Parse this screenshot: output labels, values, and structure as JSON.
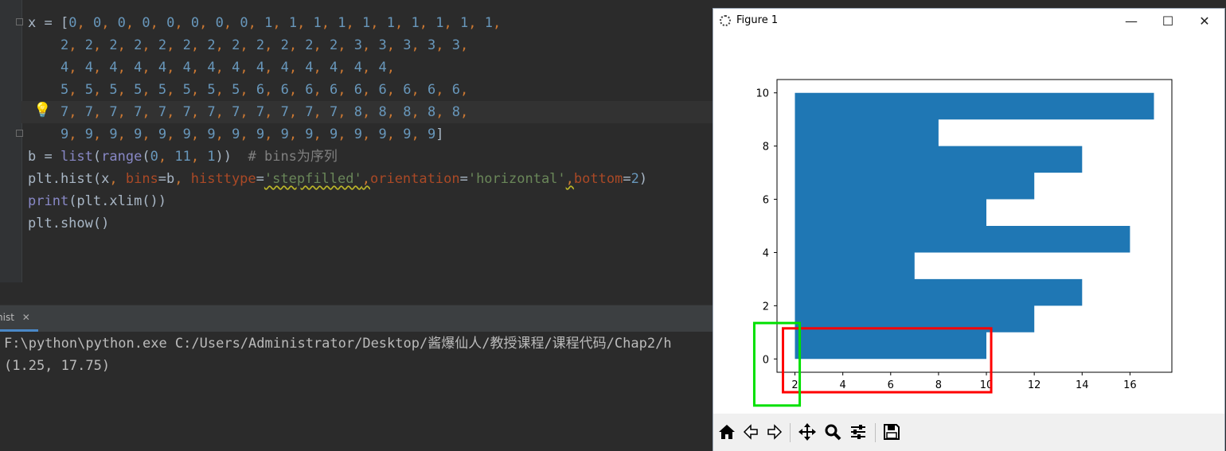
{
  "editor": {
    "lines": [
      [
        [
          "x",
          ""
        ],
        [
          " = [",
          ""
        ],
        [
          "0",
          "num"
        ],
        [
          ", ",
          "kw"
        ],
        [
          "0",
          "num"
        ],
        [
          ", ",
          "kw"
        ],
        [
          "0",
          "num"
        ],
        [
          ", ",
          "kw"
        ],
        [
          "0",
          "num"
        ],
        [
          ", ",
          "kw"
        ],
        [
          "0",
          "num"
        ],
        [
          ", ",
          "kw"
        ],
        [
          "0",
          "num"
        ],
        [
          ", ",
          "kw"
        ],
        [
          "0",
          "num"
        ],
        [
          ", ",
          "kw"
        ],
        [
          "0",
          "num"
        ],
        [
          ", ",
          "kw"
        ],
        [
          "1",
          "num"
        ],
        [
          ", ",
          "kw"
        ],
        [
          "1",
          "num"
        ],
        [
          ", ",
          "kw"
        ],
        [
          "1",
          "num"
        ],
        [
          ", ",
          "kw"
        ],
        [
          "1",
          "num"
        ],
        [
          ", ",
          "kw"
        ],
        [
          "1",
          "num"
        ],
        [
          ", ",
          "kw"
        ],
        [
          "1",
          "num"
        ],
        [
          ", ",
          "kw"
        ],
        [
          "1",
          "num"
        ],
        [
          ", ",
          "kw"
        ],
        [
          "1",
          "num"
        ],
        [
          ", ",
          "kw"
        ],
        [
          "1",
          "num"
        ],
        [
          ", ",
          "kw"
        ],
        [
          "1",
          "num"
        ],
        [
          ",",
          "kw"
        ]
      ],
      [
        [
          "    ",
          ""
        ],
        [
          "2",
          "num"
        ],
        [
          ", ",
          "kw"
        ],
        [
          "2",
          "num"
        ],
        [
          ", ",
          "kw"
        ],
        [
          "2",
          "num"
        ],
        [
          ", ",
          "kw"
        ],
        [
          "2",
          "num"
        ],
        [
          ", ",
          "kw"
        ],
        [
          "2",
          "num"
        ],
        [
          ", ",
          "kw"
        ],
        [
          "2",
          "num"
        ],
        [
          ", ",
          "kw"
        ],
        [
          "2",
          "num"
        ],
        [
          ", ",
          "kw"
        ],
        [
          "2",
          "num"
        ],
        [
          ", ",
          "kw"
        ],
        [
          "2",
          "num"
        ],
        [
          ", ",
          "kw"
        ],
        [
          "2",
          "num"
        ],
        [
          ", ",
          "kw"
        ],
        [
          "2",
          "num"
        ],
        [
          ", ",
          "kw"
        ],
        [
          "2",
          "num"
        ],
        [
          ", ",
          "kw"
        ],
        [
          "3",
          "num"
        ],
        [
          ", ",
          "kw"
        ],
        [
          "3",
          "num"
        ],
        [
          ", ",
          "kw"
        ],
        [
          "3",
          "num"
        ],
        [
          ", ",
          "kw"
        ],
        [
          "3",
          "num"
        ],
        [
          ", ",
          "kw"
        ],
        [
          "3",
          "num"
        ],
        [
          ",",
          "kw"
        ]
      ],
      [
        [
          "    ",
          ""
        ],
        [
          "4",
          "num"
        ],
        [
          ", ",
          "kw"
        ],
        [
          "4",
          "num"
        ],
        [
          ", ",
          "kw"
        ],
        [
          "4",
          "num"
        ],
        [
          ", ",
          "kw"
        ],
        [
          "4",
          "num"
        ],
        [
          ", ",
          "kw"
        ],
        [
          "4",
          "num"
        ],
        [
          ", ",
          "kw"
        ],
        [
          "4",
          "num"
        ],
        [
          ", ",
          "kw"
        ],
        [
          "4",
          "num"
        ],
        [
          ", ",
          "kw"
        ],
        [
          "4",
          "num"
        ],
        [
          ", ",
          "kw"
        ],
        [
          "4",
          "num"
        ],
        [
          ", ",
          "kw"
        ],
        [
          "4",
          "num"
        ],
        [
          ", ",
          "kw"
        ],
        [
          "4",
          "num"
        ],
        [
          ", ",
          "kw"
        ],
        [
          "4",
          "num"
        ],
        [
          ", ",
          "kw"
        ],
        [
          "4",
          "num"
        ],
        [
          ", ",
          "kw"
        ],
        [
          "4",
          "num"
        ],
        [
          ",",
          "kw"
        ]
      ],
      [
        [
          "    ",
          ""
        ],
        [
          "5",
          "num"
        ],
        [
          ", ",
          "kw"
        ],
        [
          "5",
          "num"
        ],
        [
          ", ",
          "kw"
        ],
        [
          "5",
          "num"
        ],
        [
          ", ",
          "kw"
        ],
        [
          "5",
          "num"
        ],
        [
          ", ",
          "kw"
        ],
        [
          "5",
          "num"
        ],
        [
          ", ",
          "kw"
        ],
        [
          "5",
          "num"
        ],
        [
          ", ",
          "kw"
        ],
        [
          "5",
          "num"
        ],
        [
          ", ",
          "kw"
        ],
        [
          "5",
          "num"
        ],
        [
          ", ",
          "kw"
        ],
        [
          "6",
          "num"
        ],
        [
          ", ",
          "kw"
        ],
        [
          "6",
          "num"
        ],
        [
          ", ",
          "kw"
        ],
        [
          "6",
          "num"
        ],
        [
          ", ",
          "kw"
        ],
        [
          "6",
          "num"
        ],
        [
          ", ",
          "kw"
        ],
        [
          "6",
          "num"
        ],
        [
          ", ",
          "kw"
        ],
        [
          "6",
          "num"
        ],
        [
          ", ",
          "kw"
        ],
        [
          "6",
          "num"
        ],
        [
          ", ",
          "kw"
        ],
        [
          "6",
          "num"
        ],
        [
          ", ",
          "kw"
        ],
        [
          "6",
          "num"
        ],
        [
          ",",
          "kw"
        ]
      ],
      [
        [
          "    ",
          ""
        ],
        [
          "7",
          "num"
        ],
        [
          ", ",
          "kw"
        ],
        [
          "7",
          "num"
        ],
        [
          ", ",
          "kw"
        ],
        [
          "7",
          "num"
        ],
        [
          ", ",
          "kw"
        ],
        [
          "7",
          "num"
        ],
        [
          ", ",
          "kw"
        ],
        [
          "7",
          "num"
        ],
        [
          ", ",
          "kw"
        ],
        [
          "7",
          "num"
        ],
        [
          ", ",
          "kw"
        ],
        [
          "7",
          "num"
        ],
        [
          ", ",
          "kw"
        ],
        [
          "7",
          "num"
        ],
        [
          ", ",
          "kw"
        ],
        [
          "7",
          "num"
        ],
        [
          ", ",
          "kw"
        ],
        [
          "7",
          "num"
        ],
        [
          ", ",
          "kw"
        ],
        [
          "7",
          "num"
        ],
        [
          ", ",
          "kw"
        ],
        [
          "7",
          "num"
        ],
        [
          ", ",
          "kw"
        ],
        [
          "8",
          "num"
        ],
        [
          ", ",
          "kw"
        ],
        [
          "8",
          "num"
        ],
        [
          ", ",
          "kw"
        ],
        [
          "8",
          "num"
        ],
        [
          ", ",
          "kw"
        ],
        [
          "8",
          "num"
        ],
        [
          ", ",
          "kw"
        ],
        [
          "8",
          "num"
        ],
        [
          ",",
          "kw"
        ]
      ],
      [
        [
          "    ",
          ""
        ],
        [
          "9",
          "num"
        ],
        [
          ", ",
          "kw"
        ],
        [
          "9",
          "num"
        ],
        [
          ", ",
          "kw"
        ],
        [
          "9",
          "num"
        ],
        [
          ", ",
          "kw"
        ],
        [
          "9",
          "num"
        ],
        [
          ", ",
          "kw"
        ],
        [
          "9",
          "num"
        ],
        [
          ", ",
          "kw"
        ],
        [
          "9",
          "num"
        ],
        [
          ", ",
          "kw"
        ],
        [
          "9",
          "num"
        ],
        [
          ", ",
          "kw"
        ],
        [
          "9",
          "num"
        ],
        [
          ", ",
          "kw"
        ],
        [
          "9",
          "num"
        ],
        [
          ", ",
          "kw"
        ],
        [
          "9",
          "num"
        ],
        [
          ", ",
          "kw"
        ],
        [
          "9",
          "num"
        ],
        [
          ", ",
          "kw"
        ],
        [
          "9",
          "num"
        ],
        [
          ", ",
          "kw"
        ],
        [
          "9",
          "num"
        ],
        [
          ", ",
          "kw"
        ],
        [
          "9",
          "num"
        ],
        [
          ", ",
          "kw"
        ],
        [
          "9",
          "num"
        ],
        [
          ", ",
          "kw"
        ],
        [
          "9",
          "num"
        ],
        [
          "]",
          ""
        ]
      ],
      [
        [
          "b = ",
          ""
        ],
        [
          "list",
          "builtin"
        ],
        [
          "(",
          ""
        ],
        [
          "range",
          "builtin"
        ],
        [
          "(",
          ""
        ],
        [
          "0",
          "num"
        ],
        [
          ", ",
          "kw"
        ],
        [
          "11",
          "num"
        ],
        [
          ", ",
          "kw"
        ],
        [
          "1",
          "num"
        ],
        [
          "))  ",
          ""
        ],
        [
          "# bins为序列",
          "cmt"
        ]
      ],
      [
        [
          "plt.hist(x",
          ""
        ],
        [
          ", ",
          "kw"
        ],
        [
          "bins",
          "param"
        ],
        [
          "=b",
          ""
        ],
        [
          ", ",
          "kw"
        ],
        [
          "histtype",
          "param"
        ],
        [
          "=",
          ""
        ],
        [
          "'stepfilled'",
          "str-warn"
        ],
        [
          ",",
          "kw-warn"
        ],
        [
          "orientation",
          "param"
        ],
        [
          "=",
          ""
        ],
        [
          "'horizontal'",
          "str"
        ],
        [
          ",",
          "kw-warn"
        ],
        [
          "bottom",
          "param"
        ],
        [
          "=",
          ""
        ],
        [
          "2",
          "num"
        ],
        [
          ")",
          ""
        ]
      ],
      [
        [
          "print",
          "builtin"
        ],
        [
          "(plt.xlim())",
          ""
        ]
      ],
      [
        [
          "plt.show()",
          ""
        ]
      ]
    ]
  },
  "run_panel": {
    "tab_label": "hist",
    "tab_close": "✕",
    "console_lines": [
      "F:\\python\\python.exe C:/Users/Administrator/Desktop/酱爆仙人/教授课程/课程代码/Chap2/h",
      "(1.25, 17.75)"
    ]
  },
  "figure": {
    "title": "Figure 1",
    "minimize": "—",
    "maximize": "☐",
    "close": "✕",
    "toolbar": [
      "home-icon",
      "back-icon",
      "forward-icon",
      "pan-icon",
      "zoom-icon",
      "configure-icon",
      "save-icon"
    ]
  },
  "chart_data": {
    "type": "bar",
    "orientation": "horizontal",
    "histtype": "stepfilled",
    "bins": [
      0,
      1,
      2,
      3,
      4,
      5,
      6,
      7,
      8,
      9,
      10
    ],
    "counts": [
      8,
      10,
      12,
      5,
      14,
      8,
      10,
      12,
      6,
      15
    ],
    "bottom": 2,
    "xlim": [
      1.25,
      17.75
    ],
    "ylim": [
      -0.5,
      10.5
    ],
    "xticks": [
      2,
      4,
      6,
      8,
      10,
      12,
      14,
      16
    ],
    "yticks": [
      0,
      2,
      4,
      6,
      8,
      10
    ],
    "color": "#1f77b4",
    "title": "",
    "xlabel": "",
    "ylabel": "",
    "annotations": [
      {
        "type": "rectangle",
        "color": "#ff0000",
        "x_range": [
          1.5,
          10.2
        ],
        "y_range": [
          -1.25,
          1.15
        ]
      },
      {
        "type": "rectangle",
        "color": "#00e000",
        "x_range": [
          0.3,
          2.2
        ],
        "y_range": [
          -1.75,
          1.35
        ]
      }
    ]
  }
}
